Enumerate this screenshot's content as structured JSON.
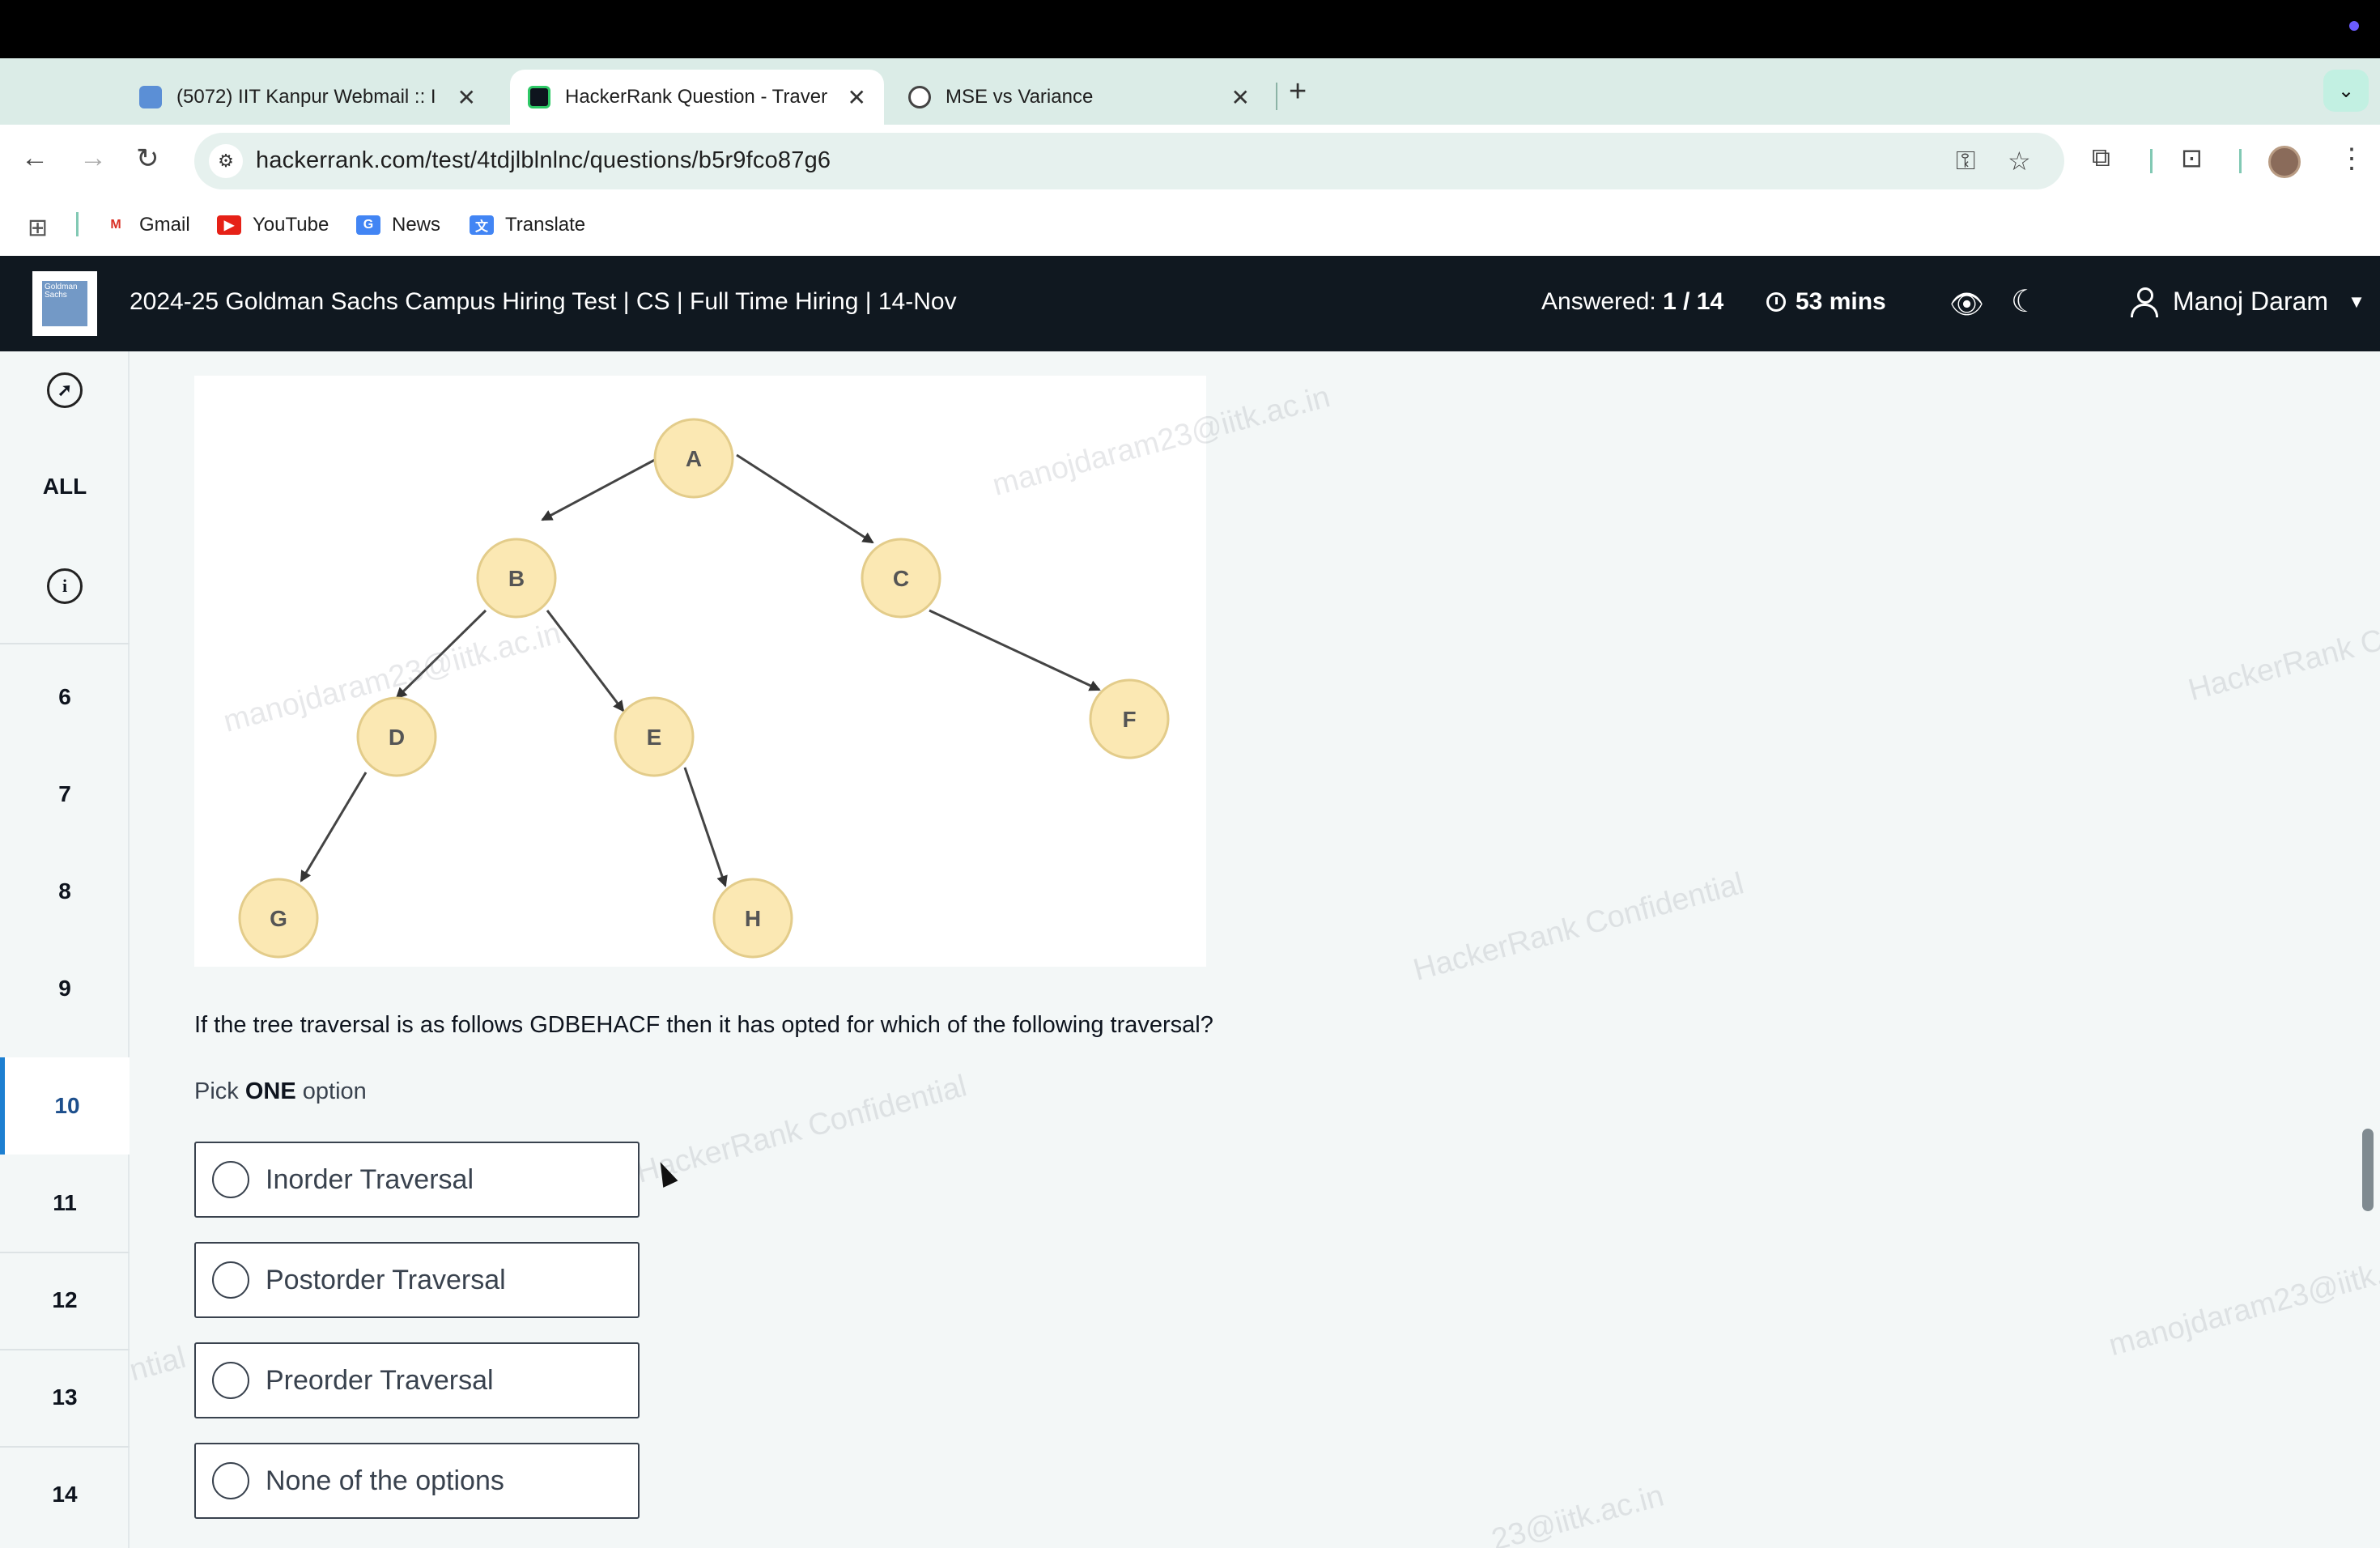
{
  "browser": {
    "tabs": [
      {
        "title": "(5072) IIT Kanpur Webmail :: I",
        "favicon": "webmail-favicon"
      },
      {
        "title": "HackerRank Question - Traver",
        "favicon": "hackerrank-favicon",
        "active": true
      },
      {
        "title": "MSE vs Variance",
        "favicon": "chatgpt-favicon"
      }
    ],
    "url": "hackerrank.com/test/4tdjlblnlnc/questions/b5r9fco87g6",
    "bookmarks": [
      {
        "label": "Gmail",
        "icon": "gmail-icon"
      },
      {
        "label": "YouTube",
        "icon": "youtube-icon"
      },
      {
        "label": "News",
        "icon": "news-icon"
      },
      {
        "label": "Translate",
        "icon": "translate-icon"
      }
    ]
  },
  "header": {
    "test_title": "2024-25 Goldman Sachs Campus Hiring Test | CS | Full Time Hiring | 14-Nov",
    "answered_label": "Answered:",
    "answered_value": "1 / 14",
    "time_left": "53 mins",
    "user_name": "Manoj Daram",
    "logo_text": "Goldman Sachs"
  },
  "sidebar": {
    "all_label": "ALL",
    "questions": [
      "6",
      "7",
      "8",
      "9",
      "10",
      "11",
      "12",
      "13",
      "14"
    ],
    "active_question": "10"
  },
  "question": {
    "tree_nodes": [
      "A",
      "B",
      "C",
      "D",
      "E",
      "F",
      "G",
      "H"
    ],
    "text": "If the tree traversal is as follows GDBEHACF then it has opted for which of the following traversal?",
    "pick_prefix": "Pick",
    "pick_bold": "ONE",
    "pick_suffix": "option",
    "options": [
      "Inorder Traversal",
      "Postorder Traversal",
      "Preorder Traversal",
      "None of the options"
    ]
  },
  "watermarks": {
    "email": "manojdaram23@iitk.ac.in",
    "confidential": "HackerRank Confidential",
    "partial_confidential": "HackerRank Co",
    "partial_ntial": "ntial",
    "partial_email": "manojdaram23@iitk.a",
    "partial_email_bottom": "23@iitk.ac.in"
  },
  "colors": {
    "header_bg": "#101820",
    "active_accent": "#1d7fd1",
    "node_fill": "#fbe8b3",
    "node_stroke": "#e3cc8a"
  }
}
